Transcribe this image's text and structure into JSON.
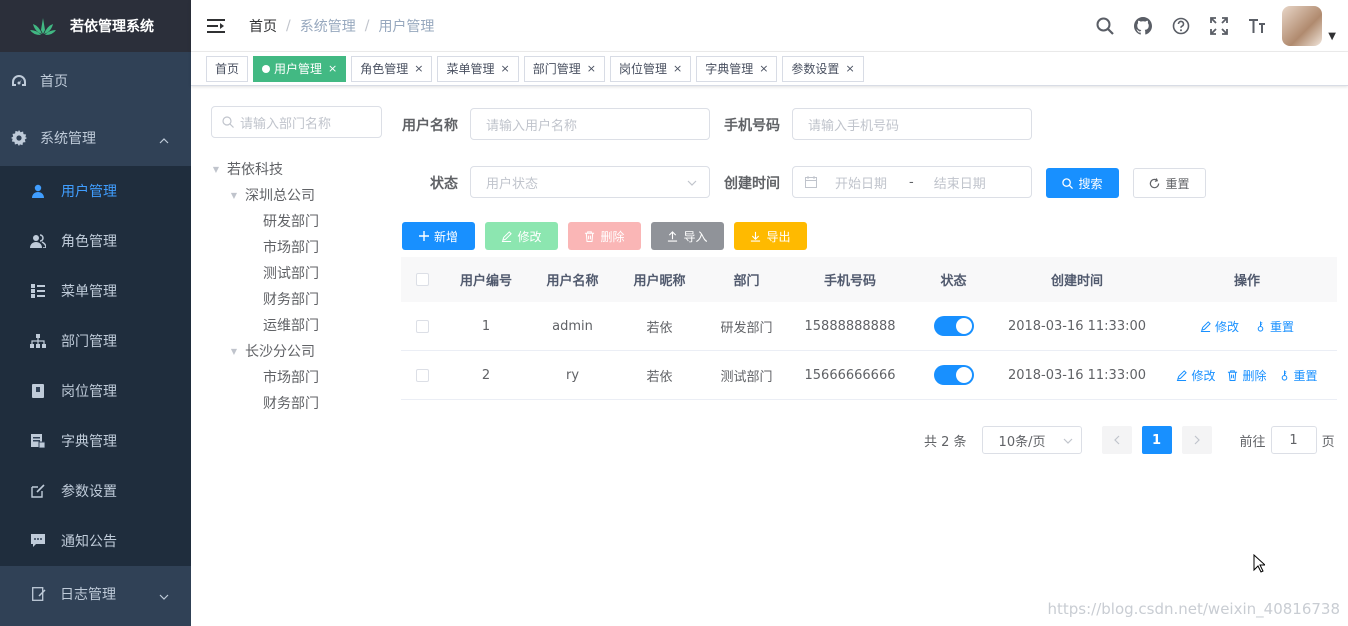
{
  "app": {
    "title": "若依管理系统"
  },
  "sidebar": {
    "items": [
      {
        "label": "首页",
        "icon": "dashboard-icon"
      },
      {
        "label": "系统管理",
        "icon": "gear-icon",
        "expanded": true
      }
    ],
    "sub": [
      {
        "label": "用户管理",
        "icon": "user-icon",
        "active": true
      },
      {
        "label": "角色管理",
        "icon": "peoples-icon"
      },
      {
        "label": "菜单管理",
        "icon": "tree-table-icon"
      },
      {
        "label": "部门管理",
        "icon": "tree-icon"
      },
      {
        "label": "岗位管理",
        "icon": "post-icon"
      },
      {
        "label": "字典管理",
        "icon": "dict-icon"
      },
      {
        "label": "参数设置",
        "icon": "edit-icon"
      },
      {
        "label": "通知公告",
        "icon": "message-icon"
      }
    ],
    "log": {
      "label": "日志管理",
      "icon": "log-icon"
    }
  },
  "breadcrumb": [
    "首页",
    "系统管理",
    "用户管理"
  ],
  "tags": [
    {
      "label": "首页"
    },
    {
      "label": "用户管理",
      "active": true
    },
    {
      "label": "角色管理"
    },
    {
      "label": "菜单管理"
    },
    {
      "label": "部门管理"
    },
    {
      "label": "岗位管理"
    },
    {
      "label": "字典管理"
    },
    {
      "label": "参数设置"
    }
  ],
  "tags_close": "×",
  "dept": {
    "placeholder": "请输入部门名称",
    "tree": [
      {
        "label": "若依科技",
        "level": 0,
        "expanded": true
      },
      {
        "label": "深圳总公司",
        "level": 1,
        "expanded": true
      },
      {
        "label": "研发部门",
        "level": 2
      },
      {
        "label": "市场部门",
        "level": 2
      },
      {
        "label": "测试部门",
        "level": 2
      },
      {
        "label": "财务部门",
        "level": 2
      },
      {
        "label": "运维部门",
        "level": 2
      },
      {
        "label": "长沙分公司",
        "level": 1,
        "expanded": true
      },
      {
        "label": "市场部门",
        "level": 2
      },
      {
        "label": "财务部门",
        "level": 2
      }
    ]
  },
  "query": {
    "username_label": "用户名称",
    "username_placeholder": "请输入用户名称",
    "phone_label": "手机号码",
    "phone_placeholder": "请输入手机号码",
    "status_label": "状态",
    "status_placeholder": "用户状态",
    "time_label": "创建时间",
    "start_placeholder": "开始日期",
    "range_sep": "-",
    "end_placeholder": "结束日期",
    "search_label": "搜索",
    "reset_label": "重置"
  },
  "toolbar": {
    "add": "新增",
    "edit": "修改",
    "delete": "删除",
    "import": "导入",
    "export": "导出",
    "colors": {
      "add": "#1890ff",
      "edit": "#8ce6b0",
      "delete": "#fab6b6",
      "import": "#909399",
      "export": "#ffba00"
    }
  },
  "table": {
    "headers": [
      "用户编号",
      "用户名称",
      "用户昵称",
      "部门",
      "手机号码",
      "状态",
      "创建时间",
      "操作"
    ],
    "rows": [
      {
        "id": "1",
        "username": "admin",
        "nickname": "若依",
        "dept": "研发部门",
        "phone": "15888888888",
        "status": true,
        "created": "2018-03-16 11:33:00",
        "ops": [
          "修改",
          "重置"
        ]
      },
      {
        "id": "2",
        "username": "ry",
        "nickname": "若依",
        "dept": "测试部门",
        "phone": "15666666666",
        "status": true,
        "created": "2018-03-16 11:33:00",
        "ops": [
          "修改",
          "删除",
          "重置"
        ]
      }
    ]
  },
  "pagination": {
    "total": "共 2 条",
    "size": "10条/页",
    "current": "1",
    "goto_label": "前往",
    "goto_value": "1",
    "page_suffix": "页"
  },
  "watermark": "https://blog.csdn.net/weixin_40816738"
}
